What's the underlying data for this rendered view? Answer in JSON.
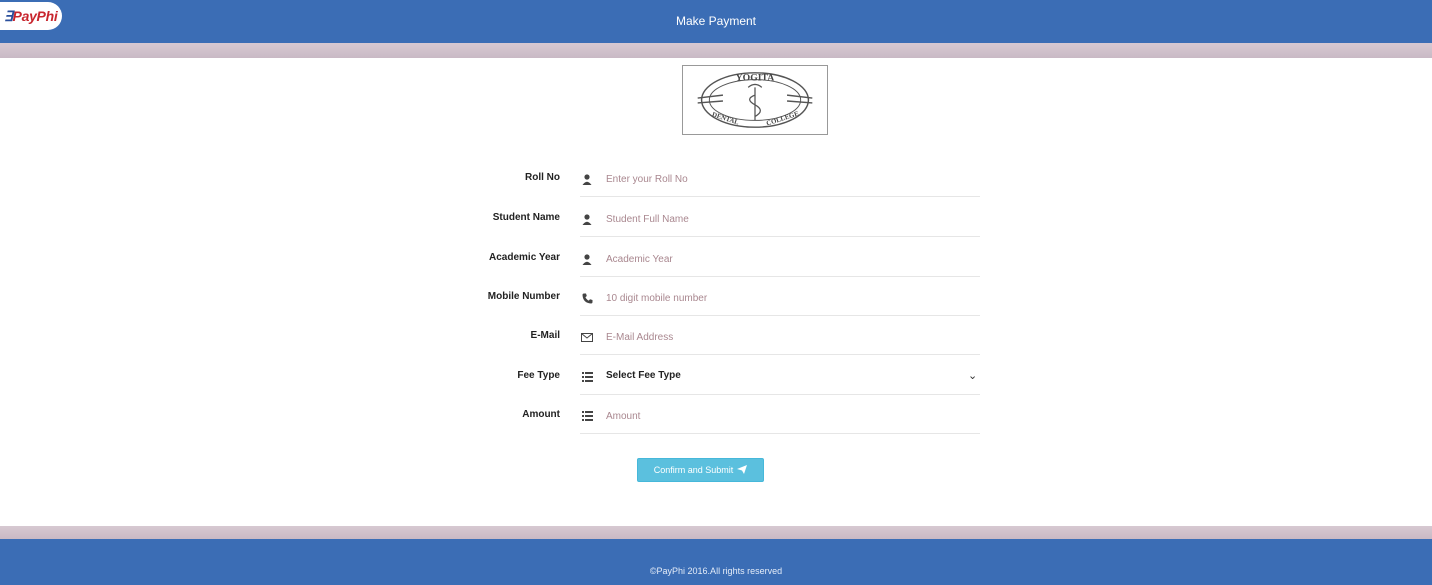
{
  "header": {
    "brand_prefix": "∃",
    "brand_name": "PayPhi",
    "title": "Make Payment"
  },
  "colors": {
    "header_bg": "#3b6db5",
    "button_bg": "#5bc0de"
  },
  "logo": {
    "top_text": "YOGITA",
    "bottom_left": "DENTAL",
    "bottom_right": "COLLEGE"
  },
  "form": {
    "rows": [
      {
        "label": "Roll No",
        "icon": "user-icon",
        "placeholder": "Enter your Roll No"
      },
      {
        "label": "Student Name",
        "icon": "user-icon",
        "placeholder": "Student Full Name"
      },
      {
        "label": "Academic Year",
        "icon": "user-icon",
        "placeholder": "Academic Year"
      },
      {
        "label": "Mobile Number",
        "icon": "phone-icon",
        "placeholder": "10 digit mobile number"
      },
      {
        "label": "E-Mail",
        "icon": "envelope-icon",
        "placeholder": "E-Mail Address"
      },
      {
        "label": "Fee Type",
        "icon": "list-icon",
        "selected": "Select Fee Type"
      },
      {
        "label": "Amount",
        "icon": "list-icon",
        "placeholder": "Amount"
      }
    ],
    "submit_label": "Confirm and Submit"
  },
  "footer": {
    "text": "©PayPhi 2016.All rights reserved"
  }
}
